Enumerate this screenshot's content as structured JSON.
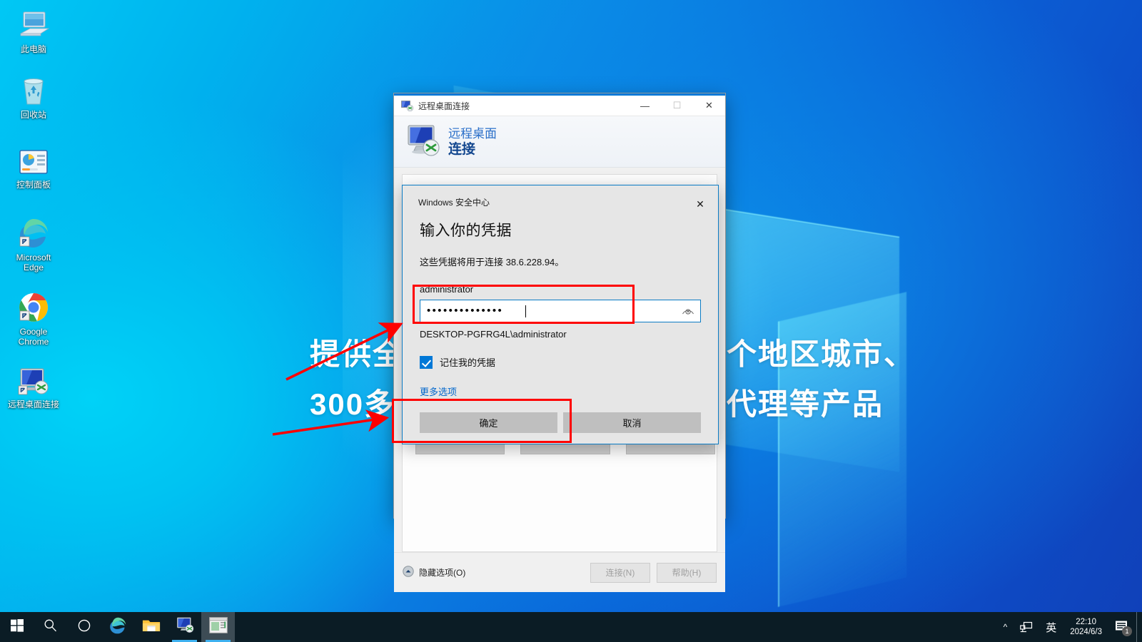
{
  "desktop": {
    "icons": [
      {
        "label": "此电脑",
        "icon": "this-pc-icon"
      },
      {
        "label": "回收站",
        "icon": "recycle-bin-icon"
      },
      {
        "label": "控制面板",
        "icon": "control-panel-icon"
      },
      {
        "label": "Microsoft Edge",
        "icon": "microsoft-edge-icon"
      },
      {
        "label": "Google Chrome",
        "icon": "google-chrome-icon"
      },
      {
        "label": "远程桌面连接",
        "icon": "remote-desktop-icon"
      }
    ],
    "watermark": {
      "line1_left": "提供全",
      "line2_left": "300多",
      "line1_right": "个地区城市、",
      "line2_right": "代理等产品"
    }
  },
  "rdp_window": {
    "title": "远程桌面连接",
    "title_icon": "remote-desktop-icon",
    "banner_line1": "远程桌面",
    "banner_line2": "连接",
    "controls": {
      "minimize": "—",
      "maximize": "☐",
      "close": "✕"
    },
    "footer": {
      "hide_options_label": "隐藏选项(O)",
      "hide_options_icon": "chevron-up-circle-icon",
      "connect_label": "连接(N)",
      "help_label": "帮助(H)"
    },
    "behind_buttons": [
      "",
      "",
      ""
    ]
  },
  "credential_dialog": {
    "app_name": "Windows 安全中心",
    "close_icon": "close-icon",
    "heading": "输入你的凭据",
    "subtitle": "这些凭据将用于连接 38.6.228.94。",
    "username": "administrator",
    "password_value": "••••••••••••••",
    "password_reveal_icon": "eye-reveal-icon",
    "domain_user": "DESKTOP-PGFRG4L\\administrator",
    "remember_label": "记住我的凭据",
    "remember_checked": true,
    "more_options_label": "更多选项",
    "ok_label": "确定",
    "cancel_label": "取消"
  },
  "annotations": {
    "highlight_color": "#fe0000",
    "boxes": [
      "password-field",
      "ok-button"
    ],
    "arrows": 2
  },
  "taskbar": {
    "start_icon": "windows-start-icon",
    "search_icon": "search-icon",
    "cortana_icon": "cortana-circle-icon",
    "pinned": [
      {
        "icon": "microsoft-edge-icon",
        "name": "microsoft-edge"
      },
      {
        "icon": "file-explorer-icon",
        "name": "file-explorer"
      }
    ],
    "running": [
      {
        "icon": "remote-desktop-icon",
        "name": "remote-desktop-connection",
        "active": false
      },
      {
        "icon": "window-app-icon",
        "name": "foreground-app",
        "active": true
      }
    ],
    "tray": {
      "chevron": "^",
      "network_icon": "network-icon",
      "ime_label": "英",
      "time": "22:10",
      "date": "2024/6/3",
      "notification_count": "1",
      "notification_icon": "action-center-icon"
    }
  }
}
